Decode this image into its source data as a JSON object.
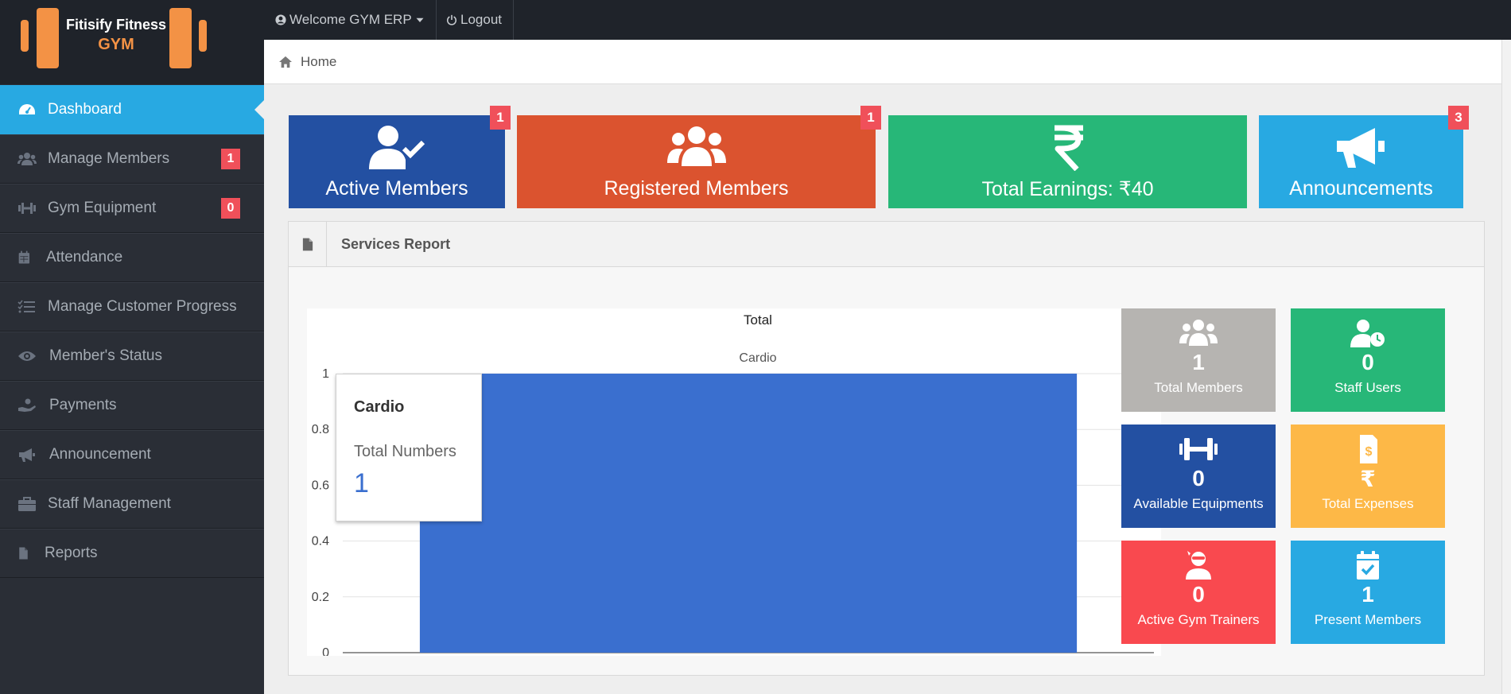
{
  "brand": {
    "line1": "Fitisify Fitness",
    "line2": "GYM",
    "accent": "#f39245"
  },
  "header": {
    "welcome": "Welcome GYM ERP",
    "logout": "Logout"
  },
  "breadcrumb": {
    "home": "Home"
  },
  "sidebar": {
    "items": [
      {
        "label": "Dashboard",
        "icon": "dashboard-icon",
        "active": true
      },
      {
        "label": "Manage Members",
        "icon": "users-icon",
        "badge": "1"
      },
      {
        "label": "Gym Equipment",
        "icon": "dumbbell-icon",
        "badge": "0"
      },
      {
        "label": "Attendance",
        "icon": "calendar-icon"
      },
      {
        "label": "Manage Customer Progress",
        "icon": "tasks-icon"
      },
      {
        "label": "Member's Status",
        "icon": "eye-icon"
      },
      {
        "label": "Payments",
        "icon": "hand-coin-icon"
      },
      {
        "label": "Announcement",
        "icon": "megaphone-icon"
      },
      {
        "label": "Staff Management",
        "icon": "briefcase-icon"
      },
      {
        "label": "Reports",
        "icon": "file-icon"
      }
    ]
  },
  "tiles": [
    {
      "label": "Active Members",
      "badge": "1",
      "color": "#2350a2",
      "icon": "user-check-icon"
    },
    {
      "label": "Registered Members",
      "badge": "1",
      "color": "#db532f",
      "icon": "users-icon"
    },
    {
      "label": "Total Earnings: ₹40",
      "color": "#27b778",
      "icon": "rupee-icon"
    },
    {
      "label": "Announcements",
      "badge": "3",
      "color": "#28a9e2",
      "icon": "megaphone-icon"
    }
  ],
  "panel": {
    "title": "Services Report"
  },
  "chart_data": {
    "type": "bar",
    "title": "Total",
    "categories": [
      "Cardio"
    ],
    "series": [
      {
        "name": "Total Numbers",
        "values": [
          1
        ]
      }
    ],
    "ylim": [
      0,
      1
    ],
    "yticks": [
      "0",
      "0.2",
      "0.4",
      "0.6",
      "0.8",
      "1"
    ],
    "bar_color": "#3a6fcf",
    "grid": true
  },
  "tooltip": {
    "title": "Cardio",
    "label": "Total Numbers",
    "value": "1"
  },
  "stats": [
    {
      "value": "1",
      "label": "Total Members",
      "color": "#b6b4b1",
      "icon": "users-icon"
    },
    {
      "value": "0",
      "label": "Staff Users",
      "color": "#27b778",
      "icon": "user-clock-icon"
    },
    {
      "value": "0",
      "label": "Available Equipments",
      "color": "#2350a2",
      "icon": "dumbbell-icon"
    },
    {
      "value": "₹",
      "label": "Total Expenses",
      "color": "#fdb847",
      "icon": "invoice-dollar-icon"
    },
    {
      "value": "0",
      "label": "Active Gym Trainers",
      "color": "#f9494f",
      "icon": "ninja-icon"
    },
    {
      "value": "1",
      "label": "Present Members",
      "color": "#28a9e2",
      "icon": "calendar-check-icon"
    }
  ]
}
